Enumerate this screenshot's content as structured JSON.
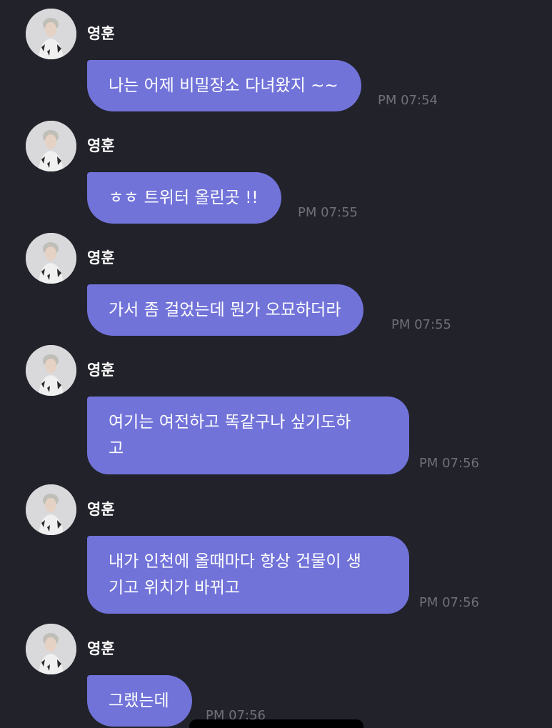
{
  "chat": {
    "messages": [
      {
        "sender": "영훈",
        "text": "나는 어제 비밀장소 다녀왔지 ~~",
        "time": "PM 07:54"
      },
      {
        "sender": "영훈",
        "text": "ㅎㅎ 트위터 올린곳 !!",
        "time": "PM 07:55"
      },
      {
        "sender": "영훈",
        "text": "가서 좀 걸었는데 뭔가 오묘하더라",
        "time": "PM 07:55"
      },
      {
        "sender": "영훈",
        "text": "여기는 여전하고 똑같구나 싶기도하\n고",
        "time": "PM 07:56"
      },
      {
        "sender": "영훈",
        "text": "내가 인천에 올때마다 항상 건물이 생\n기고 위치가 바뀌고",
        "time": "PM 07:56"
      },
      {
        "sender": "영훈",
        "text": "그랬는데",
        "time": "PM 07:56"
      }
    ]
  },
  "colors": {
    "background": "#22222b",
    "bubble": "#7173d9",
    "timestamp": "#707079",
    "text": "#ffffff"
  },
  "icons": {
    "avatar": "profile-photo"
  }
}
